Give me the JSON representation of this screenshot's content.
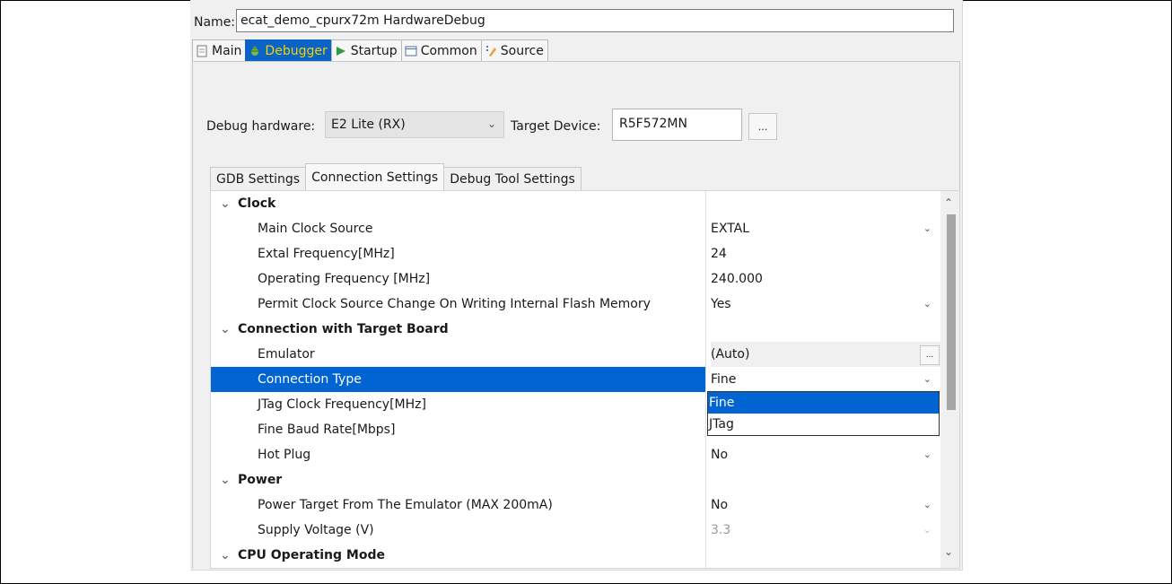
{
  "name_field": {
    "label": "Name:",
    "value": "ecat_demo_cpurx72m HardwareDebug"
  },
  "tabs": [
    {
      "label": "Main",
      "icon": "document-icon"
    },
    {
      "label": "Debugger",
      "icon": "bug-icon"
    },
    {
      "label": "Startup",
      "icon": "play-icon"
    },
    {
      "label": "Common",
      "icon": "window-icon"
    },
    {
      "label": "Source",
      "icon": "source-icon"
    }
  ],
  "debug_hardware": {
    "label": "Debug hardware:",
    "value": "E2 Lite (RX)"
  },
  "target_device": {
    "label": "Target Device:",
    "value": "R5F572MN",
    "browse_label": "..."
  },
  "subtabs": [
    "GDB Settings",
    "Connection Settings",
    "Debug Tool Settings"
  ],
  "grid": {
    "rows": [
      {
        "label": "Clock",
        "value": ""
      },
      {
        "label": "Main Clock Source",
        "value": "EXTAL"
      },
      {
        "label": "Extal Frequency[MHz]",
        "value": "24"
      },
      {
        "label": "Operating Frequency [MHz]",
        "value": "240.000"
      },
      {
        "label": "Permit Clock Source Change On Writing Internal Flash Memory",
        "value": "Yes"
      },
      {
        "label": "Connection with Target Board",
        "value": ""
      },
      {
        "label": "Emulator",
        "value": "(Auto)",
        "button": "..."
      },
      {
        "label": "Connection Type",
        "value": "Fine"
      },
      {
        "label": "JTag Clock Frequency[MHz]",
        "value": ""
      },
      {
        "label": "Fine Baud Rate[Mbps]",
        "value": ""
      },
      {
        "label": "Hot Plug",
        "value": "No"
      },
      {
        "label": "Power",
        "value": ""
      },
      {
        "label": "Power Target From The Emulator (MAX 200mA)",
        "value": "No"
      },
      {
        "label": "Supply Voltage (V)",
        "value": "3.3"
      },
      {
        "label": "CPU Operating Mode",
        "value": ""
      }
    ]
  },
  "dropdown": {
    "options": [
      "Fine",
      "JTag"
    ],
    "selected": "Fine"
  },
  "colors": {
    "selection": "#0064d2",
    "active_tab": "#0a64c8",
    "active_tab_text": "#f5d000"
  }
}
